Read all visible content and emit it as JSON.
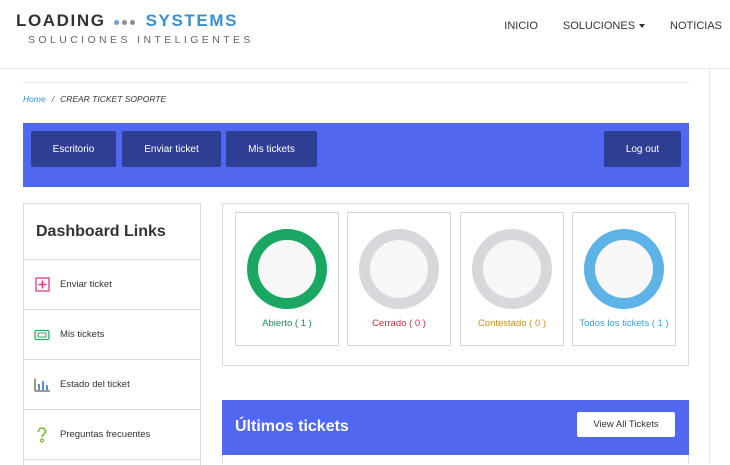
{
  "brand": {
    "name_left": "LOADING",
    "name_right": "SYSTEMS",
    "tagline": "SOLUCIONES INTELIGENTES",
    "dot_colors": [
      "#6aa2d8",
      "#8c8c8c",
      "#8c8c8c"
    ]
  },
  "nav": {
    "items": [
      {
        "label": "INICIO"
      },
      {
        "label": "SOLUCIONES"
      },
      {
        "label": "NOTICIAS"
      }
    ]
  },
  "breadcrumb": {
    "home": "Home",
    "separator": "/",
    "current": "CREAR TICKET SOPORTE"
  },
  "toolbar": {
    "buttons": [
      {
        "label": "Escritorio"
      },
      {
        "label": "Enviar ticket"
      },
      {
        "label": "Mis tickets"
      }
    ],
    "logout": "Log out"
  },
  "sidebar": {
    "title": "Dashboard Links",
    "items": [
      {
        "label": "Enviar ticket",
        "icon": "plus-square-icon",
        "color": "#d63b8f"
      },
      {
        "label": "Mis tickets",
        "icon": "ticket-icon",
        "color": "#2aa56a"
      },
      {
        "label": "Estado del ticket",
        "icon": "bar-chart-icon",
        "color": "#555555"
      },
      {
        "label": "Preguntas frecuentes",
        "icon": "question-icon",
        "color": "#79b83a"
      }
    ]
  },
  "stats": [
    {
      "label": "Abierto ( 1 )",
      "ring": "#1aa663",
      "text": "#1e8a59"
    },
    {
      "label": "Cerrado ( 0 )",
      "ring": "#d6d8db",
      "text": "#c2303c"
    },
    {
      "label": "Contestado ( 0 )",
      "ring": "#d6d8db",
      "text": "#c99416"
    },
    {
      "label": "Todos los tickets ( 1 )",
      "ring": "#5db3e6",
      "text": "#3a9fd8"
    }
  ],
  "latest": {
    "title": "Últimos tickets",
    "button": "View All Tickets"
  },
  "colors": {
    "accent": "#5067ef",
    "button_dark": "#2e3f93",
    "link": "#3a8fd0"
  }
}
